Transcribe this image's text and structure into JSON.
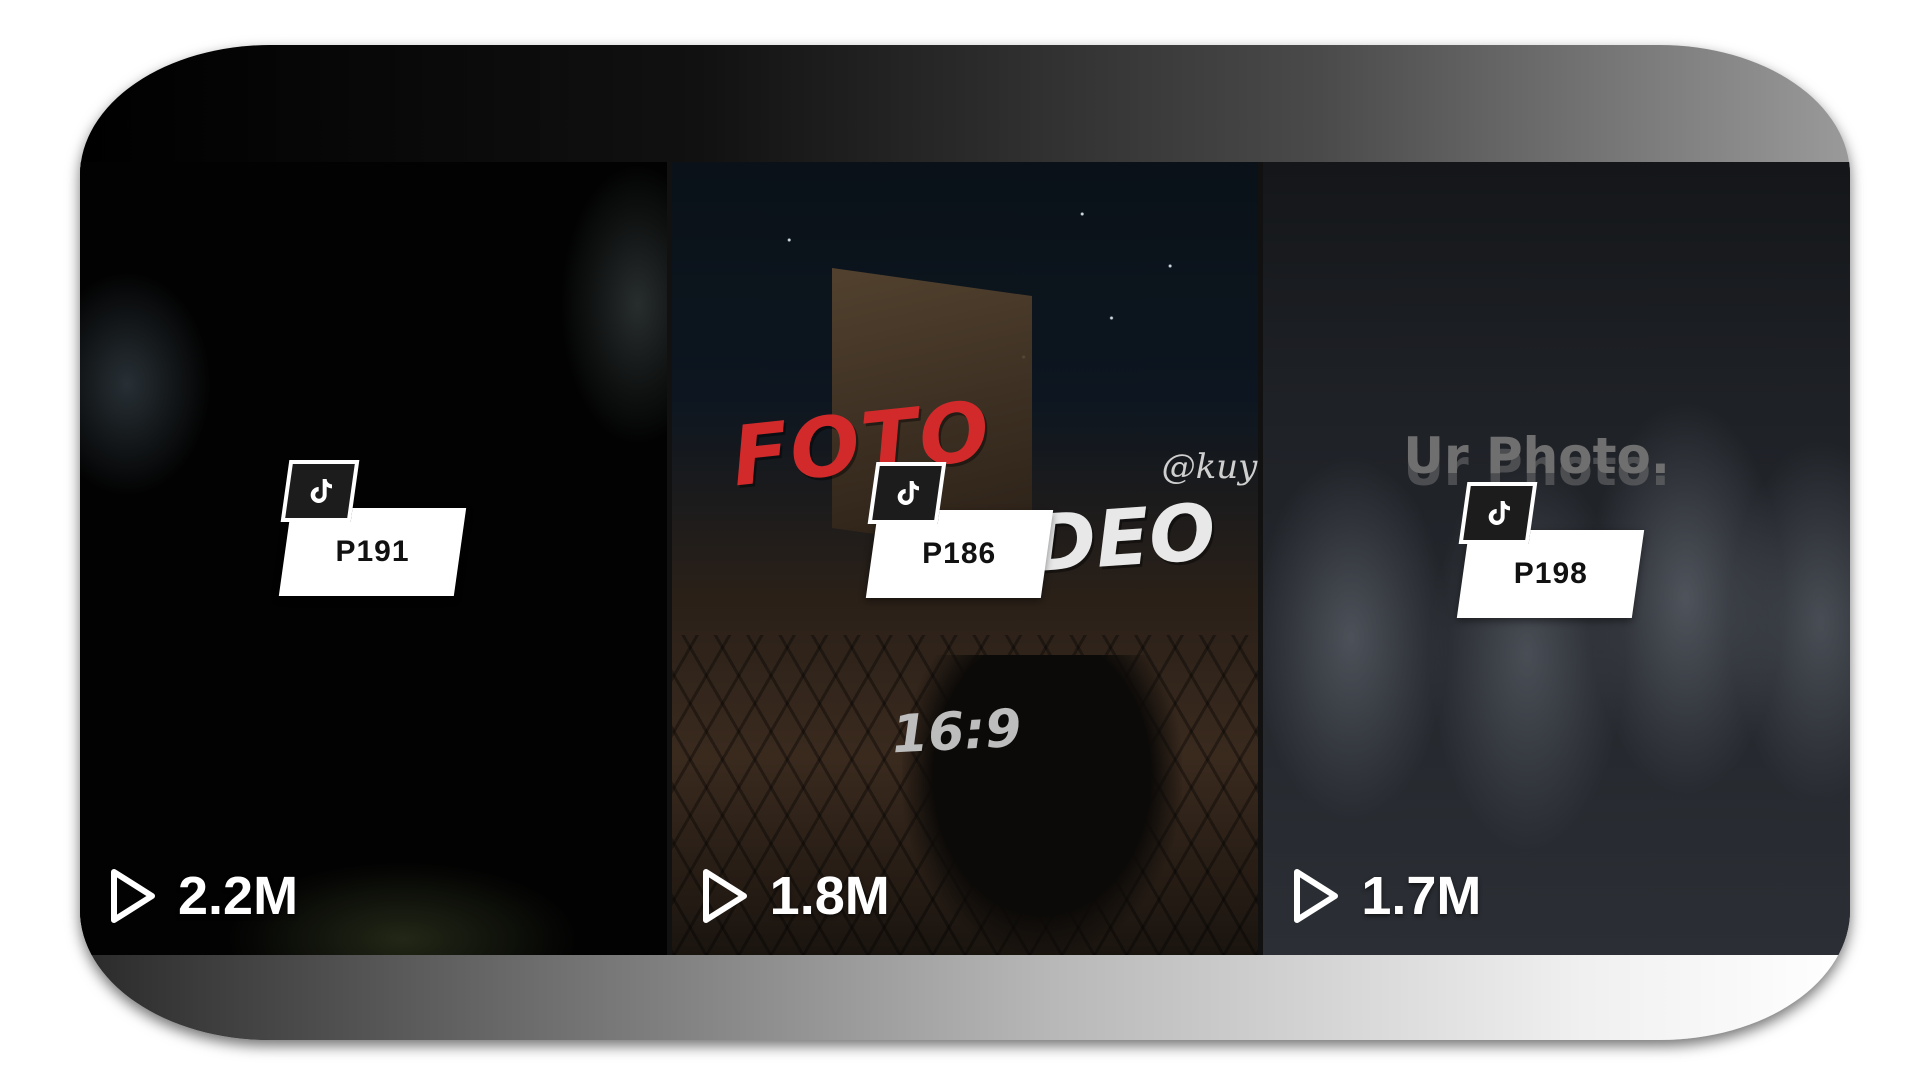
{
  "videos": [
    {
      "template_code": "P191",
      "views": "2.2M",
      "icon": "tiktok-note-icon"
    },
    {
      "template_code": "P186",
      "views": "1.8M",
      "icon": "tiktok-note-icon",
      "overlay_text": {
        "foto": "FOTO",
        "video": "VIDEO",
        "handle": "@kuya",
        "ratio": "16:9"
      }
    },
    {
      "template_code": "P198",
      "views": "1.7M",
      "icon": "tiktok-note-icon",
      "overlay_text": {
        "caption": "Ur Photo."
      }
    }
  ],
  "icons": {
    "play": "play-icon",
    "brand": "tiktok-note-icon"
  },
  "colors": {
    "badge_bg": "#ffffff",
    "badge_icon_bg": "#1c1c1c",
    "foto_red": "#d22a2a",
    "views_text": "#ffffff"
  }
}
